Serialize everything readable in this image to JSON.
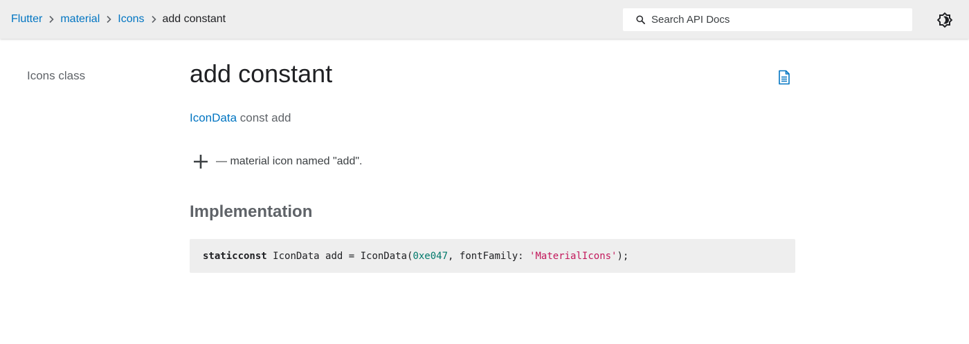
{
  "breadcrumbs": [
    {
      "label": "Flutter"
    },
    {
      "label": "material"
    },
    {
      "label": "Icons"
    }
  ],
  "breadcrumb_current": "add constant",
  "search": {
    "placeholder": "Search API Docs"
  },
  "sidebar": {
    "title": "Icons class"
  },
  "page": {
    "title": "add constant",
    "signature": {
      "type": "IconData",
      "rest": " const add"
    },
    "description": "— material icon named \"add\".",
    "implementation_title": "Implementation",
    "code": {
      "kw1": "static",
      "kw2": "const",
      "t1": " IconData add = IconData(",
      "num": "0xe047",
      "t2": ", fontFamily: ",
      "str": "'MaterialIcons'",
      "t3": ");"
    }
  },
  "icons": {
    "search": "search-icon",
    "theme": "brightness-toggle-icon",
    "source": "document-icon",
    "preview": "add-icon"
  },
  "colors": {
    "link": "#0175c2",
    "header_bg": "#eeeeee",
    "code_bg": "#eeeeee",
    "code_number": "#00796b",
    "code_string": "#c2185b"
  }
}
